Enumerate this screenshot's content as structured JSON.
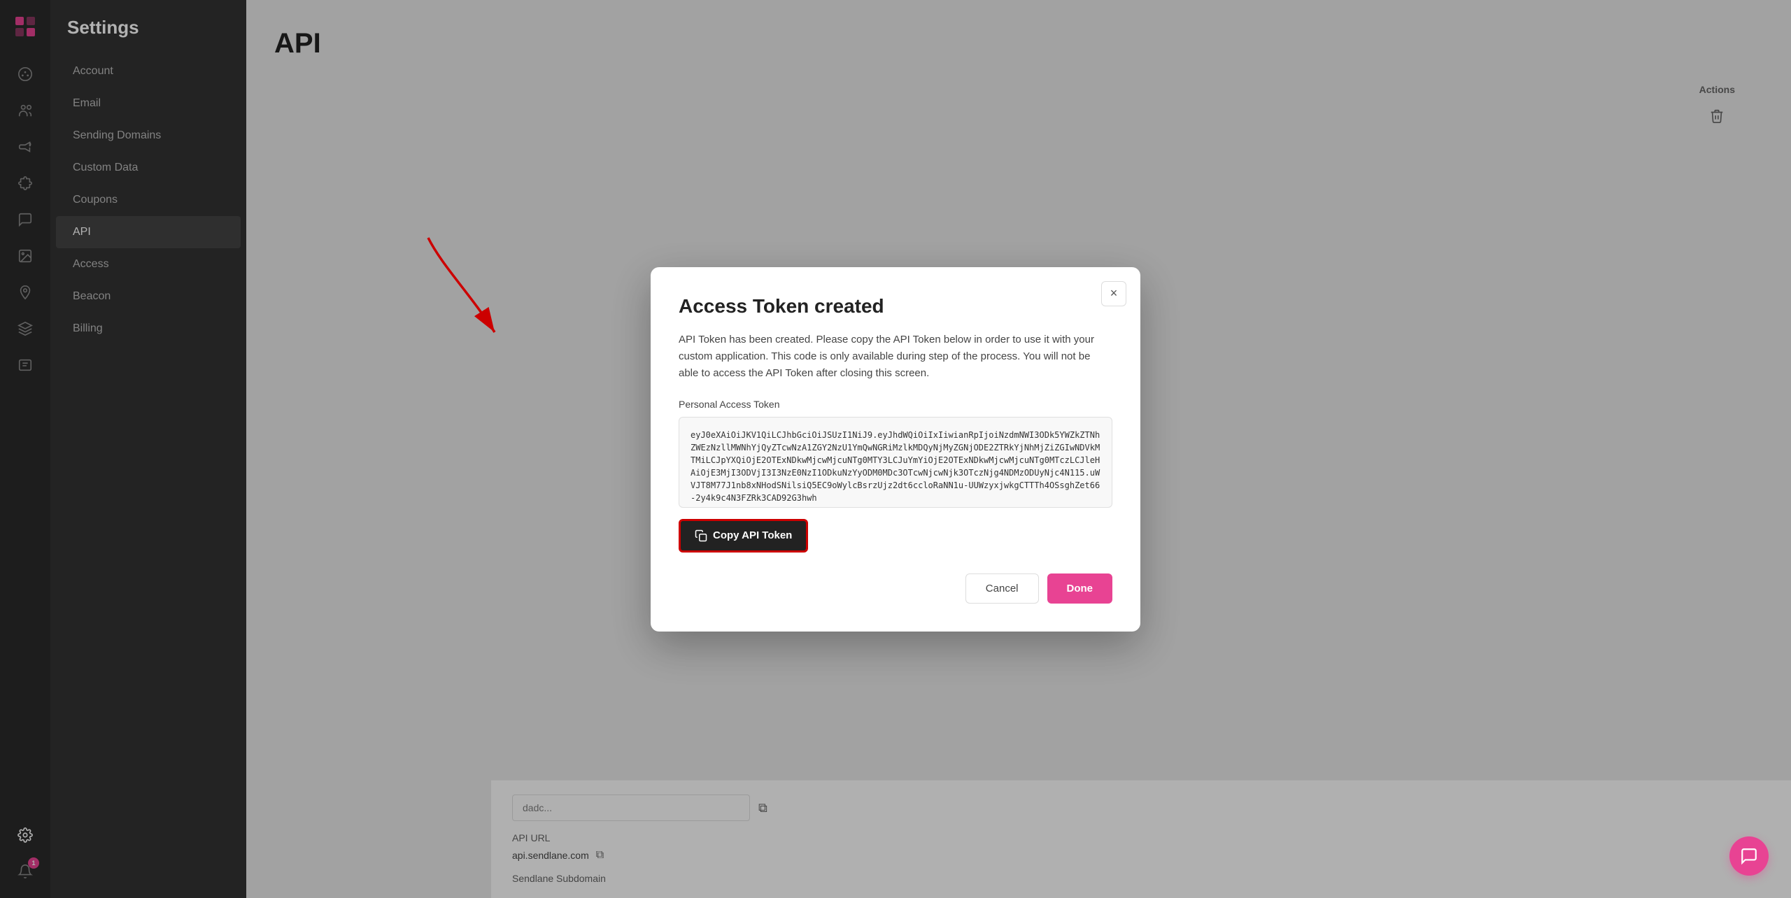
{
  "app": {
    "logo_symbol": "◈"
  },
  "icon_strip": {
    "icons": [
      {
        "name": "palette-icon",
        "symbol": "🎨",
        "label": "Design"
      },
      {
        "name": "users-icon",
        "symbol": "👥",
        "label": "Users"
      },
      {
        "name": "megaphone-icon",
        "symbol": "📣",
        "label": "Campaigns"
      },
      {
        "name": "puzzle-icon",
        "symbol": "🧩",
        "label": "Integrations"
      },
      {
        "name": "chat-icon",
        "symbol": "💬",
        "label": "Chat"
      },
      {
        "name": "image-icon",
        "symbol": "🖼",
        "label": "Media"
      },
      {
        "name": "map-pin-icon",
        "symbol": "📍",
        "label": "Location"
      },
      {
        "name": "layers-icon",
        "symbol": "🗂",
        "label": "Layers"
      },
      {
        "name": "list-icon",
        "symbol": "📋",
        "label": "List"
      },
      {
        "name": "settings-icon",
        "symbol": "⚙️",
        "label": "Settings"
      },
      {
        "name": "notification-icon",
        "symbol": "🔔",
        "label": "Notifications",
        "badge": "1"
      }
    ]
  },
  "settings_sidebar": {
    "title": "Settings",
    "nav_items": [
      {
        "label": "Account",
        "active": false
      },
      {
        "label": "Email",
        "active": false
      },
      {
        "label": "Sending Domains",
        "active": false
      },
      {
        "label": "Custom Data",
        "active": false
      },
      {
        "label": "Coupons",
        "active": false
      },
      {
        "label": "API",
        "active": true
      },
      {
        "label": "Access",
        "active": false
      },
      {
        "label": "Beacon",
        "active": false
      },
      {
        "label": "Billing",
        "active": false
      }
    ]
  },
  "page": {
    "title": "API"
  },
  "bg_content": {
    "actions_label": "Actions",
    "api_url_label": "API URL",
    "api_url_value": "api.sendlane.com",
    "subdomain_label": "Sendlane Subdomain",
    "token_placeholder": "dadc..."
  },
  "modal": {
    "title": "Access Token created",
    "close_label": "×",
    "description": "API Token has been created. Please copy the API Token below in order to use it with your custom application. This code is only available during step of the process. You will not be able to access the API Token after closing this screen.",
    "token_section_label": "Personal Access Token",
    "token_value": "eyJ0eXAiOiJKV1QiLCJhbGciOiJSUzI1NiJ9.eyJhdWQiOiIxIiwianRpIjoiNzdmNWI3ODk5YWZkZTNhZWEzNzllMWNhYjQyZTcwNzA1ZGY2NzU1YmQwNGRiMzlkMDQyNjMyZGNjODE2ZTRkYjNhMjZiZGIwNDVkMTMiLCJpYXQiOjE2OTExNDkwMjcwMjcuNTg0MTY3LCJuYmYiOjE2OTExNDkwMjcwMjcuNTg0MTczLCJleHAiOjE3MjI3ODVjI3I3NzE0NzI1ODkuNzYyODM0MDc3OTcwNjcwNjk3OTczNjg4NDMzODUyNjc4N115.uWVJT8M77J1nb8xNHodSNilsiQ5EC9oWylcBsrzUjz2dt6ccloRaNN1u-UUWzyxjwkgCTTTh4OSsghZet66-2y4k9c4N3FZRk3CAD92G3hwh",
    "copy_btn_label": "Copy API Token",
    "cancel_btn_label": "Cancel",
    "done_btn_label": "Done"
  },
  "chat_fab": {
    "icon": "💬"
  }
}
